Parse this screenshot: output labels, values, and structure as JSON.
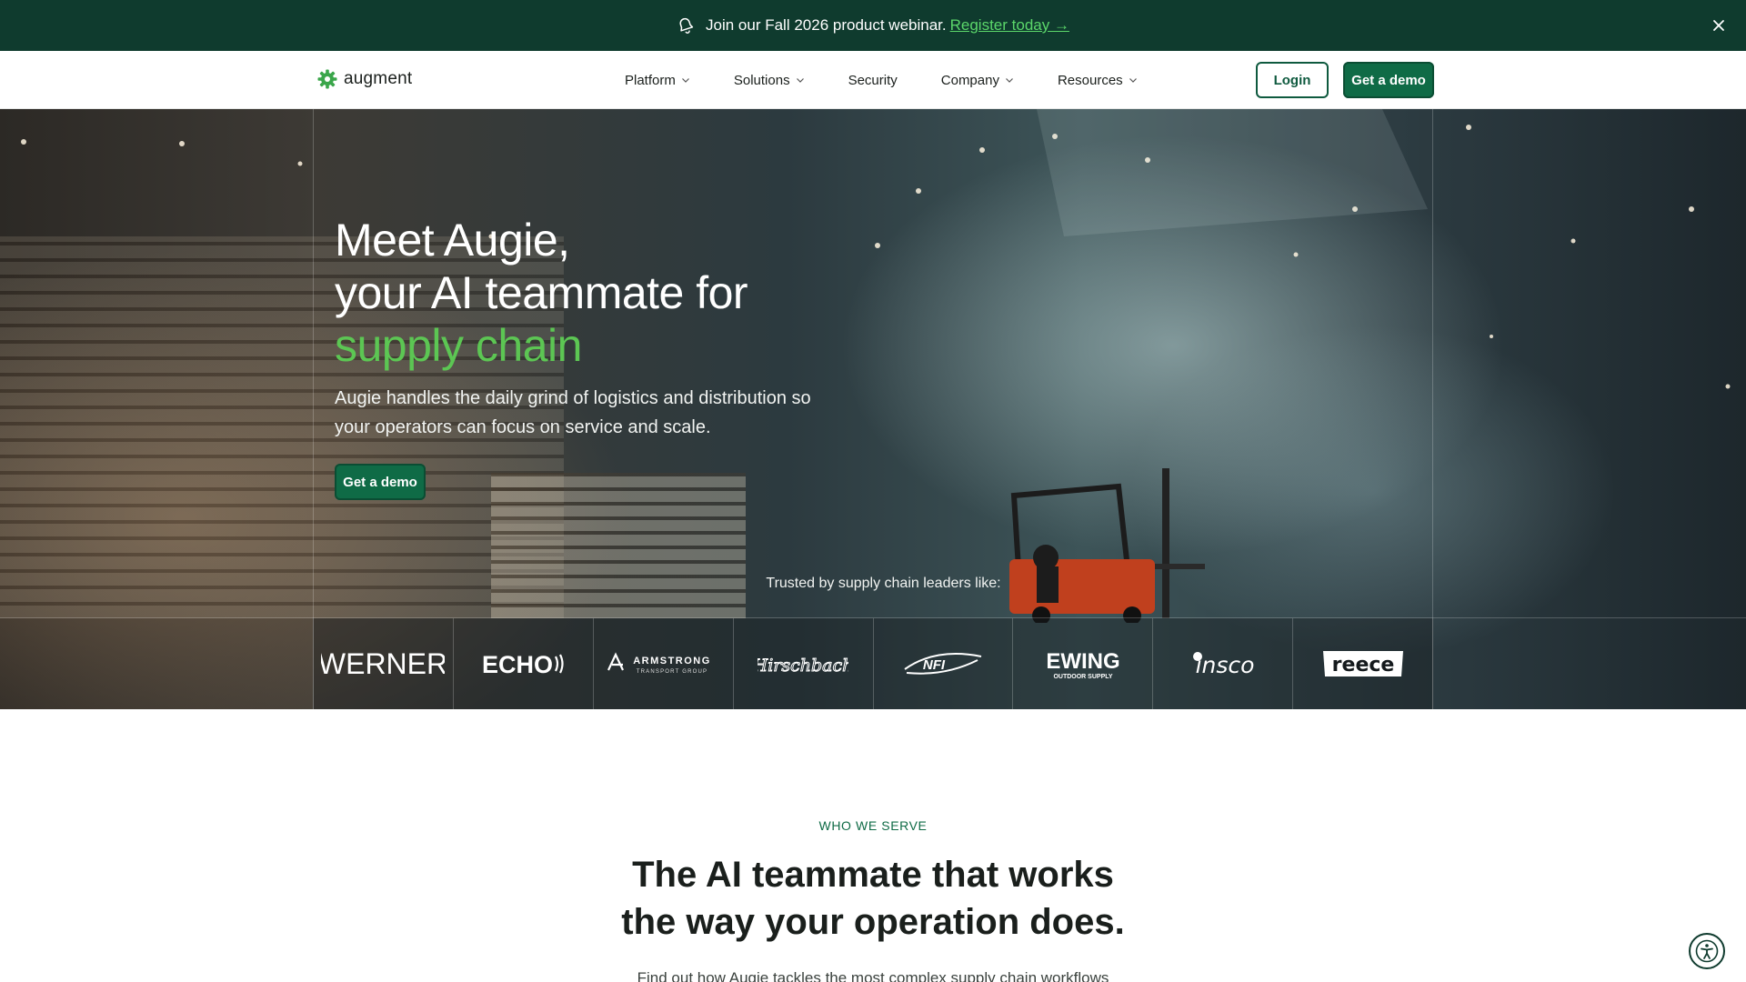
{
  "announcement": {
    "text": "Join our Fall 2026 product webinar.",
    "link": "Register today →",
    "icon": "bell-icon",
    "close_icon": "close-icon"
  },
  "nav": {
    "brand": "augment",
    "menu": [
      {
        "label": "Platform",
        "dropdown": true
      },
      {
        "label": "Solutions",
        "dropdown": true
      },
      {
        "label": "Security",
        "dropdown": false
      },
      {
        "label": "Company",
        "dropdown": true
      },
      {
        "label": "Resources",
        "dropdown": true
      }
    ],
    "login_label": "Login",
    "demo_label": "Get a demo"
  },
  "hero": {
    "title_line1": "Meet Augie,",
    "title_line2": "your AI teammate for",
    "title_accent": "supply chain",
    "subtitle": "Augie handles the daily grind of logistics and distribution so your operators can focus on service and scale.",
    "cta_label": "Get a demo",
    "trusted_label": "Trusted by supply chain leaders like:",
    "customer_logos": [
      {
        "name": "WERNER"
      },
      {
        "name": "ECHO"
      },
      {
        "name": "ARMSTRONG",
        "tagline": "TRANSPORT GROUP"
      },
      {
        "name": "Hirschbach"
      },
      {
        "name": "NFI"
      },
      {
        "name": "EWING",
        "tagline": "OUTDOOR SUPPLY"
      },
      {
        "name": "insco"
      },
      {
        "name": "reece"
      }
    ]
  },
  "serve": {
    "eyebrow": "WHO WE SERVE",
    "title_line1": "The AI teammate that works",
    "title_line2": "the way your operation does.",
    "subtitle": "Find out how Augie tackles the most complex supply chain workflows"
  },
  "colors": {
    "banner_bg": "#0f3b2e",
    "brand_green": "#0f6b46",
    "accent_green": "#5cc653",
    "link_green": "#5bd66a"
  },
  "accessibility_icon": "accessibility-icon"
}
